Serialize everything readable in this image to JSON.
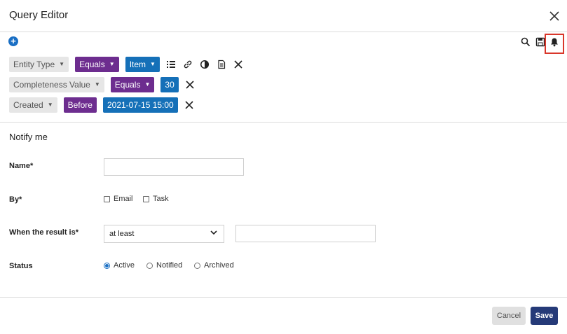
{
  "dialog": {
    "title": "Query Editor"
  },
  "toolbar": {
    "add_icon": "plus-circle-icon",
    "icons": [
      "search-icon",
      "save-icon",
      "bell-icon"
    ],
    "highlight_color": "#d9372b"
  },
  "filters": [
    {
      "field": "Entity Type",
      "operator": "Equals",
      "value": "Item",
      "value_has_caret": true,
      "actions": [
        "list-icon",
        "link-icon",
        "contrast-icon",
        "document-icon",
        "remove-icon"
      ]
    },
    {
      "field": "Completeness Value",
      "operator": "Equals",
      "value": "30",
      "value_has_caret": false,
      "actions": [
        "remove-icon"
      ]
    },
    {
      "field": "Created",
      "operator": "Before",
      "value": "2021-07-15 15:00",
      "value_has_caret": false,
      "actions": [
        "remove-icon"
      ]
    }
  ],
  "notify": {
    "section_title": "Notify me",
    "name": {
      "label": "Name*",
      "value": "",
      "placeholder": ""
    },
    "by": {
      "label": "By*",
      "options": [
        {
          "label": "Email",
          "checked": false
        },
        {
          "label": "Task",
          "checked": false
        }
      ]
    },
    "when": {
      "label": "When the result is*",
      "selected": "at least",
      "value": ""
    },
    "status": {
      "label": "Status",
      "options": [
        {
          "label": "Active",
          "selected": true
        },
        {
          "label": "Notified",
          "selected": false
        },
        {
          "label": "Archived",
          "selected": false
        }
      ]
    }
  },
  "footer": {
    "cancel_label": "Cancel",
    "save_label": "Save"
  },
  "colors": {
    "purple": "#6d2d8f",
    "blue": "#1570b8",
    "save": "#253a78"
  }
}
